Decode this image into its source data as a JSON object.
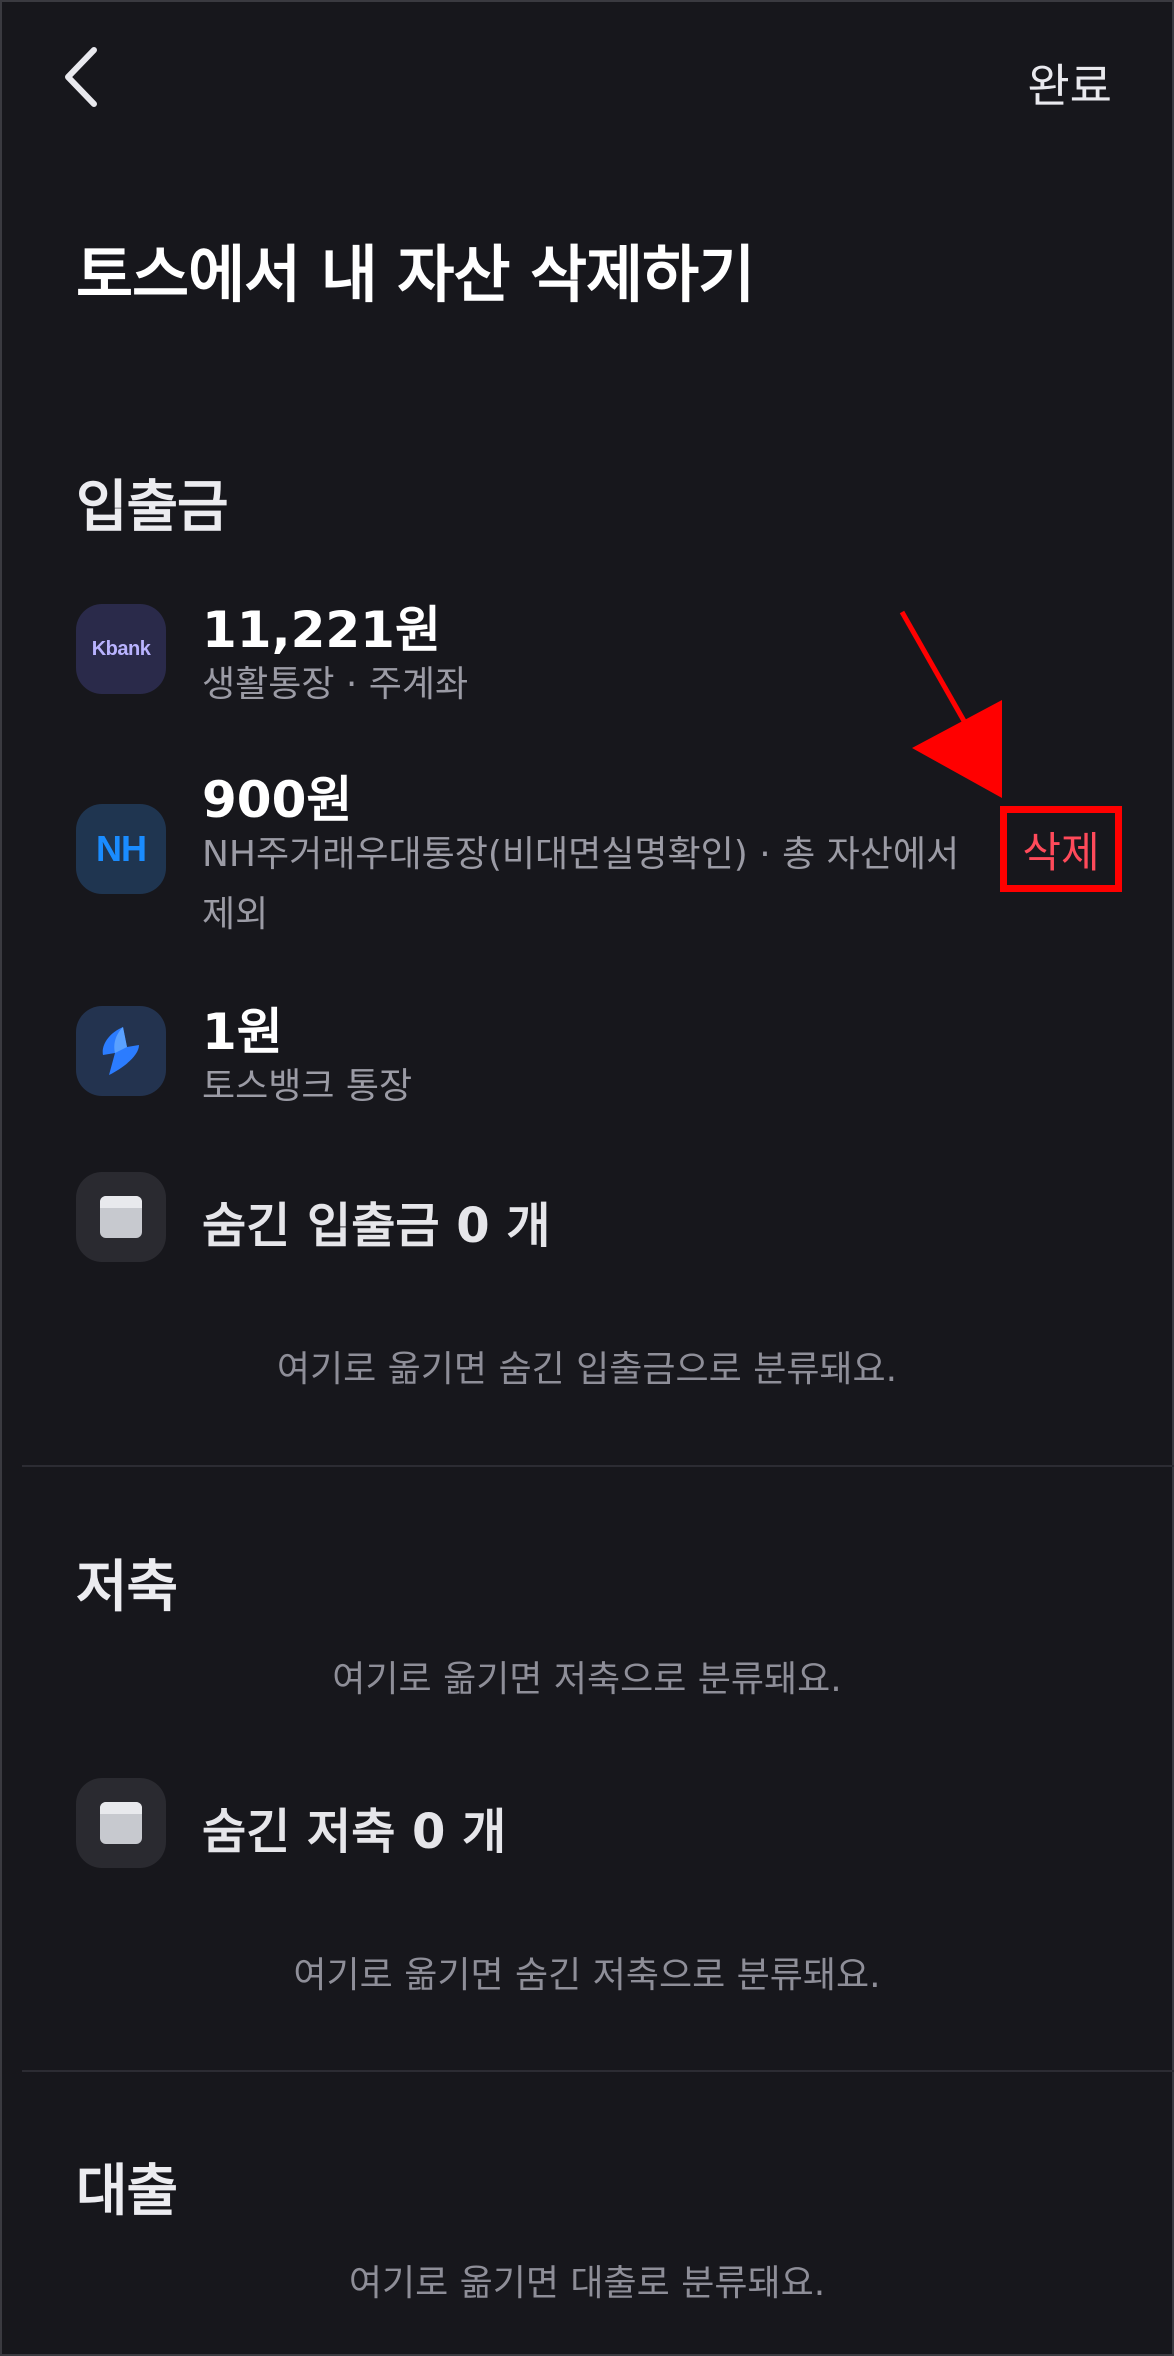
{
  "header": {
    "back_icon": "chevron-left-icon",
    "done_label": "완료"
  },
  "page": {
    "title": "토스에서 내 자산 삭제하기"
  },
  "sections": {
    "deposit": {
      "title": "입출금",
      "accounts": [
        {
          "icon": "kbank-logo",
          "logo_text": "Kbank",
          "amount": "11,221원",
          "description": "생활통장 · 주계좌",
          "icon_bg": "#2a2a4a",
          "logo_color": "#b9b3ff"
        },
        {
          "icon": "nh-logo",
          "logo_text": "NH",
          "amount": "900원",
          "description_line1": "NH주거래우대통장(비대면실명확인) · 총 자산에서",
          "description_line2": "제외",
          "delete_label": "삭제",
          "icon_bg": "#1f3550",
          "logo_color": "#1a8cff"
        },
        {
          "icon": "tossbank-logo",
          "amount": "1원",
          "description": "토스뱅크 통장",
          "icon_bg": "#23334f",
          "logo_color": "#2b7cff"
        }
      ],
      "hidden": {
        "icon": "hidden-box-icon",
        "label": "숨긴 입출금 0 개"
      },
      "hint": "여기로 옮기면 숨긴 입출금으로 분류돼요."
    },
    "savings": {
      "title": "저축",
      "hint": "여기로 옮기면 저축으로 분류돼요.",
      "hidden": {
        "icon": "hidden-box-icon",
        "label": "숨긴 저축 0 개"
      },
      "hidden_hint": "여기로 옮기면 숨긴 저축으로 분류돼요."
    },
    "loan": {
      "title": "대출",
      "hint": "여기로 옮기면 대출로 분류돼요."
    }
  },
  "annotation": {
    "arrow_color": "#ff0000",
    "highlight_color": "#ff0000"
  }
}
